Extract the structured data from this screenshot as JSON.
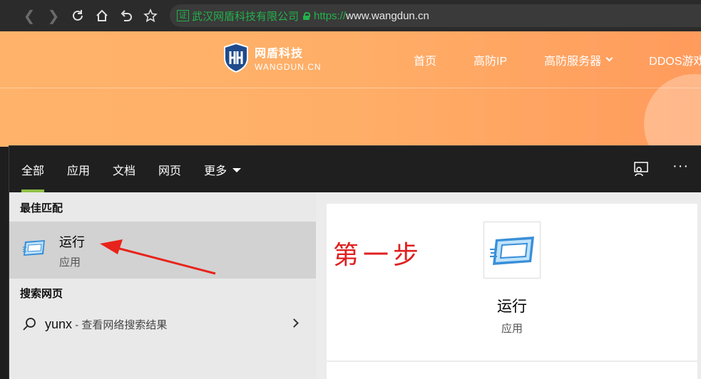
{
  "browser": {
    "cert_label": "证",
    "cert_org": "武汉网盾科技有限公司",
    "url_proto": "https://",
    "url_host": "www.wangdun.cn"
  },
  "site": {
    "logo_cn": "网盾科技",
    "logo_en": "WANGDUN.CN",
    "nav": [
      "首页",
      "高防IP",
      "高防服务器",
      "DDOS游戏盾"
    ]
  },
  "search": {
    "tabs": [
      "全部",
      "应用",
      "文档",
      "网页",
      "更多"
    ],
    "best_match_heading": "最佳匹配",
    "best_match": {
      "title": "运行",
      "subtitle": "应用"
    },
    "web_heading": "搜索网页",
    "web_query": "yunx",
    "web_desc": " - 查看网络搜索结果",
    "detail": {
      "title": "运行",
      "subtitle": "应用"
    }
  },
  "annotation": {
    "step": "第一步",
    "color": "#e02020"
  },
  "colors": {
    "accent_green": "#8fc046",
    "site_orange": "#ffae68"
  }
}
